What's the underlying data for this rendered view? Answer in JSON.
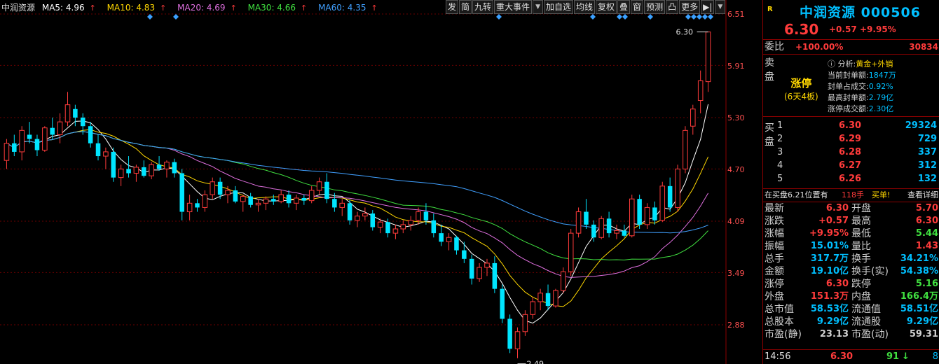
{
  "legend": {
    "name": "中润资源",
    "items": [
      {
        "label": "MA5: 4.96",
        "color": "#ffffff"
      },
      {
        "label": "MA10: 4.83",
        "color": "#ffd700"
      },
      {
        "label": "MA20: 4.69",
        "color": "#e070e0"
      },
      {
        "label": "MA30: 4.66",
        "color": "#40e040"
      },
      {
        "label": "MA60: 4.35",
        "color": "#40a0ff"
      }
    ],
    "arrow": "↑"
  },
  "toolbar": {
    "items": [
      "发",
      "简",
      "九转",
      "重大事件",
      "加自选",
      "均线",
      "复权",
      "叠",
      "窗",
      "预测",
      "凸",
      "更多",
      "▶|"
    ],
    "dropdown": "▼"
  },
  "price_axis": [
    "6.51",
    "5.91",
    "5.30",
    "4.70",
    "4.09",
    "3.49",
    "2.88"
  ],
  "chart_data": {
    "type": "candlestick",
    "y_axis": {
      "ticks": [
        6.51,
        5.91,
        5.3,
        4.7,
        4.09,
        3.49,
        2.88
      ],
      "range": [
        2.4,
        6.6
      ]
    },
    "annotations": {
      "high": "6.30",
      "low": "2.49"
    },
    "candles": [
      [
        4.8,
        5.05,
        4.7,
        5.0
      ],
      [
        5.0,
        5.1,
        4.85,
        4.9
      ],
      [
        4.9,
        5.2,
        4.8,
        5.15
      ],
      [
        5.1,
        5.25,
        5.0,
        5.05
      ],
      [
        5.05,
        5.1,
        4.85,
        4.92
      ],
      [
        4.92,
        5.2,
        4.9,
        5.18
      ],
      [
        5.18,
        5.3,
        5.05,
        5.1
      ],
      [
        5.1,
        5.35,
        5.0,
        5.25
      ],
      [
        5.25,
        5.6,
        5.2,
        5.45
      ],
      [
        5.4,
        5.45,
        5.2,
        5.3
      ],
      [
        5.3,
        5.35,
        5.1,
        5.2
      ],
      [
        5.2,
        5.25,
        4.95,
        5.0
      ],
      [
        5.0,
        5.1,
        4.8,
        4.85
      ],
      [
        4.85,
        4.95,
        4.7,
        4.9
      ],
      [
        4.9,
        4.95,
        4.55,
        4.6
      ],
      [
        4.6,
        4.75,
        4.5,
        4.7
      ],
      [
        4.7,
        4.85,
        4.6,
        4.65
      ],
      [
        4.65,
        4.75,
        4.55,
        4.72
      ],
      [
        4.72,
        4.8,
        4.6,
        4.62
      ],
      [
        4.62,
        4.78,
        4.58,
        4.75
      ],
      [
        4.75,
        4.85,
        4.68,
        4.7
      ],
      [
        4.7,
        4.8,
        4.6,
        4.78
      ],
      [
        4.78,
        4.82,
        4.6,
        4.65
      ],
      [
        4.65,
        4.7,
        4.1,
        4.2
      ],
      [
        4.2,
        4.4,
        4.1,
        4.3
      ],
      [
        4.3,
        4.35,
        4.2,
        4.25
      ],
      [
        4.25,
        4.45,
        4.2,
        4.4
      ],
      [
        4.4,
        4.6,
        4.35,
        4.55
      ],
      [
        4.55,
        4.6,
        4.35,
        4.4
      ],
      [
        4.4,
        4.5,
        4.3,
        4.45
      ],
      [
        4.45,
        4.5,
        4.3,
        4.32
      ],
      [
        4.32,
        4.4,
        4.2,
        4.38
      ],
      [
        4.38,
        4.42,
        4.25,
        4.28
      ],
      [
        4.28,
        4.35,
        4.2,
        4.3
      ],
      [
        4.3,
        4.38,
        4.22,
        4.35
      ],
      [
        4.35,
        4.4,
        4.28,
        4.32
      ],
      [
        4.32,
        4.45,
        4.3,
        4.4
      ],
      [
        4.4,
        4.45,
        4.25,
        4.3
      ],
      [
        4.3,
        4.4,
        4.22,
        4.36
      ],
      [
        4.36,
        4.4,
        4.28,
        4.33
      ],
      [
        4.33,
        4.5,
        4.3,
        4.45
      ],
      [
        4.45,
        4.6,
        4.4,
        4.55
      ],
      [
        4.55,
        4.65,
        4.3,
        4.35
      ],
      [
        4.35,
        4.42,
        4.2,
        4.25
      ],
      [
        4.25,
        4.35,
        4.15,
        4.3
      ],
      [
        4.3,
        4.34,
        4.05,
        4.1
      ],
      [
        4.1,
        4.2,
        4.02,
        4.15
      ],
      [
        4.15,
        4.25,
        4.1,
        4.18
      ],
      [
        4.18,
        4.22,
        3.98,
        4.02
      ],
      [
        4.02,
        4.12,
        3.95,
        4.08
      ],
      [
        4.08,
        4.12,
        3.9,
        3.95
      ],
      [
        3.95,
        4.05,
        3.88,
        4.0
      ],
      [
        4.0,
        4.1,
        3.95,
        4.05
      ],
      [
        4.05,
        4.15,
        3.98,
        4.1
      ],
      [
        4.1,
        4.25,
        4.05,
        4.2
      ],
      [
        4.2,
        4.3,
        4.05,
        4.1
      ],
      [
        4.1,
        4.18,
        3.9,
        3.95
      ],
      [
        3.95,
        4.05,
        3.8,
        3.85
      ],
      [
        3.85,
        3.95,
        3.75,
        3.9
      ],
      [
        3.9,
        3.92,
        3.7,
        3.75
      ],
      [
        3.75,
        3.85,
        3.6,
        3.65
      ],
      [
        3.65,
        3.7,
        3.35,
        3.42
      ],
      [
        3.42,
        3.6,
        3.38,
        3.55
      ],
      [
        3.55,
        3.65,
        3.45,
        3.6
      ],
      [
        3.6,
        3.68,
        3.25,
        3.3
      ],
      [
        3.3,
        3.35,
        2.9,
        2.95
      ],
      [
        2.95,
        3.0,
        2.55,
        2.6
      ],
      [
        2.6,
        2.85,
        2.49,
        2.8
      ],
      [
        2.8,
        3.05,
        2.75,
        3.0
      ],
      [
        3.0,
        3.2,
        2.95,
        3.15
      ],
      [
        3.15,
        3.3,
        3.05,
        3.25
      ],
      [
        3.25,
        3.35,
        3.05,
        3.1
      ],
      [
        3.1,
        3.3,
        3.08,
        3.28
      ],
      [
        3.28,
        3.55,
        3.25,
        3.5
      ],
      [
        3.5,
        4.0,
        3.45,
        3.95
      ],
      [
        3.95,
        4.25,
        3.9,
        4.2
      ],
      [
        4.2,
        4.35,
        4.0,
        4.05
      ],
      [
        4.05,
        4.1,
        3.85,
        3.9
      ],
      [
        3.9,
        4.15,
        3.88,
        4.12
      ],
      [
        4.12,
        4.2,
        3.9,
        3.95
      ],
      [
        3.95,
        4.05,
        3.88,
        3.98
      ],
      [
        3.98,
        4.05,
        3.9,
        3.92
      ],
      [
        3.92,
        4.4,
        3.9,
        4.35
      ],
      [
        4.35,
        4.4,
        4.0,
        4.05
      ],
      [
        4.05,
        4.3,
        4.0,
        4.25
      ],
      [
        4.25,
        4.32,
        4.05,
        4.1
      ],
      [
        4.1,
        4.55,
        4.08,
        4.5
      ],
      [
        4.5,
        4.6,
        4.2,
        4.25
      ],
      [
        4.25,
        4.75,
        4.2,
        4.7
      ],
      [
        4.7,
        5.2,
        4.65,
        5.15
      ],
      [
        5.2,
        5.45,
        5.1,
        5.4
      ],
      [
        5.5,
        5.85,
        5.35,
        5.73
      ],
      [
        5.72,
        6.3,
        5.6,
        6.3
      ]
    ]
  },
  "panel": {
    "r_tag": "R",
    "name": "中润资源 000506",
    "price": "6.30",
    "change": "+0.57",
    "change_pct": "+9.95%",
    "webi_label": "委比",
    "webi_pct": "+100.00%",
    "webi_val": "30834",
    "sell_label": "卖盘",
    "badge_main": "涨停",
    "badge_sub": "(6天4板)",
    "info": [
      {
        "k": "ⓘ 分析:",
        "v": "黄金+外销"
      },
      {
        "k": "当前封单额:",
        "v": "1847万"
      },
      {
        "k": "封单占成交:",
        "v": "0.92%"
      },
      {
        "k": "最高封单额:",
        "v": "2.79亿"
      },
      {
        "k": "涨停成交额:",
        "v": "2.30亿"
      }
    ],
    "buy_label": "买盘",
    "buy": [
      {
        "lv": "1",
        "pr": "6.30",
        "vol": "29324"
      },
      {
        "lv": "2",
        "pr": "6.29",
        "vol": "729"
      },
      {
        "lv": "3",
        "pr": "6.28",
        "vol": "337"
      },
      {
        "lv": "4",
        "pr": "6.27",
        "vol": "312"
      },
      {
        "lv": "5",
        "pr": "6.26",
        "vol": "132"
      }
    ],
    "notice": {
      "text": "在买盘6.21位置有",
      "qty": "118手",
      "tag": "买单!",
      "link": "查看详细"
    },
    "stats": [
      [
        "最新",
        "6.30",
        "#ff3b3b",
        "开盘",
        "5.70",
        "#ff3b3b"
      ],
      [
        "涨跌",
        "+0.57",
        "#ff3b3b",
        "最高",
        "6.30",
        "#ff3b3b"
      ],
      [
        "涨幅",
        "+9.95%",
        "#ff3b3b",
        "最低",
        "5.44",
        "#40e040"
      ],
      [
        "振幅",
        "15.01%",
        "#00bfff",
        "量比",
        "1.43",
        "#ff3b3b"
      ],
      [
        "总手",
        "317.7万",
        "#00bfff",
        "换手",
        "34.21%",
        "#00bfff"
      ],
      [
        "金额",
        "19.10亿",
        "#00bfff",
        "换手(实)",
        "54.38%",
        "#00bfff"
      ],
      [
        "涨停",
        "6.30",
        "#ff3b3b",
        "跌停",
        "5.16",
        "#40e040"
      ],
      [
        "外盘",
        "151.3万",
        "#ff3b3b",
        "内盘",
        "166.4万",
        "#40e040"
      ],
      [
        "总市值",
        "58.53亿",
        "#00bfff",
        "流通值",
        "58.51亿",
        "#00bfff"
      ],
      [
        "总股本",
        "9.29亿",
        "#00bfff",
        "流通股",
        "9.29亿",
        "#00bfff"
      ],
      [
        "市盈(静)",
        "23.13",
        "#d0d0d0",
        "市盈(动)",
        "59.31",
        "#d0d0d0"
      ]
    ],
    "footer": {
      "time": "14:56",
      "price": "6.30",
      "vol": "91",
      "arrow": "↓",
      "side": "8"
    }
  }
}
